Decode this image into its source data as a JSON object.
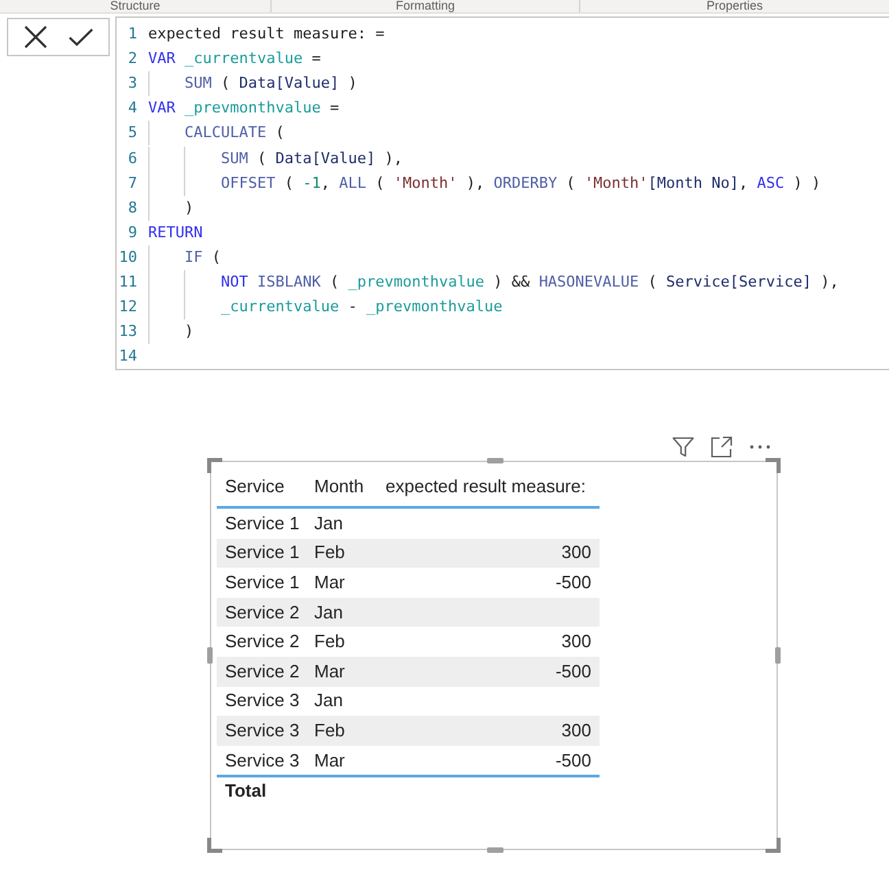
{
  "ribbon_sections": [
    {
      "label": "Structure"
    },
    {
      "label": "Formatting"
    },
    {
      "label": "Properties"
    }
  ],
  "formula": {
    "lines": [
      {
        "number": "1",
        "tokens": [
          {
            "kind": "plain",
            "text": "expected result measure: ="
          }
        ]
      },
      {
        "number": "2",
        "tokens": [
          {
            "kind": "keyword",
            "text": "VAR "
          },
          {
            "kind": "variable",
            "text": "_currentvalue"
          },
          {
            "kind": "plain",
            "text": " ="
          }
        ]
      },
      {
        "number": "3",
        "tokens": [
          {
            "kind": "function",
            "text": "    SUM"
          },
          {
            "kind": "plain",
            "text": " ( "
          },
          {
            "kind": "column",
            "text": "Data[Value]"
          },
          {
            "kind": "plain",
            "text": " )"
          }
        ]
      },
      {
        "number": "4",
        "tokens": [
          {
            "kind": "keyword",
            "text": "VAR "
          },
          {
            "kind": "variable",
            "text": "_prevmonthvalue"
          },
          {
            "kind": "plain",
            "text": " ="
          }
        ]
      },
      {
        "number": "5",
        "tokens": [
          {
            "kind": "function",
            "text": "    CALCULATE"
          },
          {
            "kind": "plain",
            "text": " ("
          }
        ]
      },
      {
        "number": "6",
        "tokens": [
          {
            "kind": "function",
            "text": "        SUM"
          },
          {
            "kind": "plain",
            "text": " ( "
          },
          {
            "kind": "column",
            "text": "Data[Value]"
          },
          {
            "kind": "plain",
            "text": " ),"
          }
        ]
      },
      {
        "number": "7",
        "tokens": [
          {
            "kind": "function",
            "text": "        OFFSET"
          },
          {
            "kind": "plain",
            "text": " ( "
          },
          {
            "kind": "number",
            "text": "-1"
          },
          {
            "kind": "plain",
            "text": ", "
          },
          {
            "kind": "function",
            "text": "ALL"
          },
          {
            "kind": "plain",
            "text": " ( "
          },
          {
            "kind": "string",
            "text": "'Month'"
          },
          {
            "kind": "plain",
            "text": " ), "
          },
          {
            "kind": "function",
            "text": "ORDERBY"
          },
          {
            "kind": "plain",
            "text": " ( "
          },
          {
            "kind": "string",
            "text": "'Month'"
          },
          {
            "kind": "column",
            "text": "[Month No]"
          },
          {
            "kind": "plain",
            "text": ", "
          },
          {
            "kind": "keyword",
            "text": "ASC"
          },
          {
            "kind": "plain",
            "text": " ) )"
          }
        ]
      },
      {
        "number": "8",
        "tokens": [
          {
            "kind": "plain",
            "text": "    )"
          }
        ]
      },
      {
        "number": "9",
        "tokens": [
          {
            "kind": "keyword",
            "text": "RETURN"
          }
        ]
      },
      {
        "number": "10",
        "tokens": [
          {
            "kind": "function",
            "text": "    IF"
          },
          {
            "kind": "plain",
            "text": " ("
          }
        ]
      },
      {
        "number": "11",
        "tokens": [
          {
            "kind": "keyword",
            "text": "        NOT "
          },
          {
            "kind": "function",
            "text": "ISBLANK"
          },
          {
            "kind": "plain",
            "text": " ( "
          },
          {
            "kind": "variable",
            "text": "_prevmonthvalue"
          },
          {
            "kind": "plain",
            "text": " ) && "
          },
          {
            "kind": "function",
            "text": "HASONEVALUE"
          },
          {
            "kind": "plain",
            "text": " ( "
          },
          {
            "kind": "column",
            "text": "Service[Service]"
          },
          {
            "kind": "plain",
            "text": " ),"
          }
        ]
      },
      {
        "number": "12",
        "tokens": [
          {
            "kind": "variable",
            "text": "        _currentvalue"
          },
          {
            "kind": "plain",
            "text": " - "
          },
          {
            "kind": "variable",
            "text": "_prevmonthvalue"
          }
        ]
      },
      {
        "number": "13",
        "tokens": [
          {
            "kind": "plain",
            "text": "    )"
          }
        ]
      },
      {
        "number": "14"
      }
    ]
  },
  "visual": {
    "selected": true,
    "table": {
      "columns": [
        "Service",
        "Month",
        "expected result measure:"
      ],
      "rows": [
        {
          "service": "Service 1",
          "month": "Jan"
        },
        {
          "service": "Service 1",
          "month": "Feb",
          "measure": "300"
        },
        {
          "service": "Service 1",
          "month": "Mar",
          "measure": "-500"
        },
        {
          "service": "Service 2",
          "month": "Jan"
        },
        {
          "service": "Service 2",
          "month": "Feb",
          "measure": "300"
        },
        {
          "service": "Service 2",
          "month": "Mar",
          "measure": "-500"
        },
        {
          "service": "Service 3",
          "month": "Jan"
        },
        {
          "service": "Service 3",
          "month": "Feb",
          "measure": "300"
        },
        {
          "service": "Service 3",
          "month": "Mar",
          "measure": "-500"
        }
      ],
      "total": "Total"
    }
  }
}
